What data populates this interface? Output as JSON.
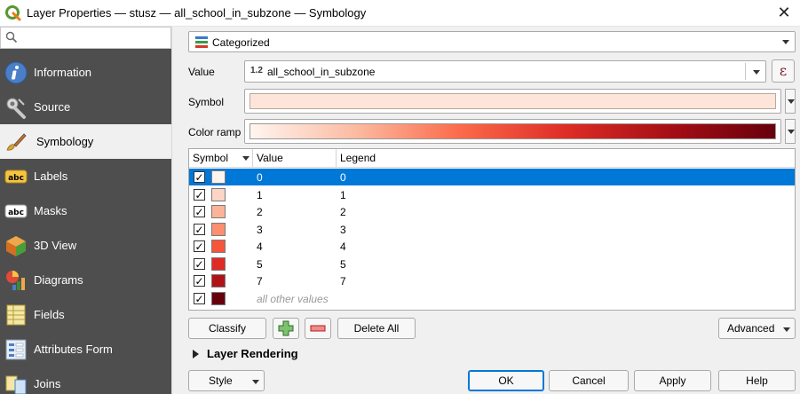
{
  "window": {
    "title": "Layer Properties — stusz — all_school_in_subzone — Symbology",
    "close_glyph": "✕"
  },
  "sidebar": {
    "search_placeholder": "",
    "items": [
      {
        "label": "Information",
        "icon": "information-icon"
      },
      {
        "label": "Source",
        "icon": "source-icon"
      },
      {
        "label": "Symbology",
        "icon": "symbology-icon",
        "active": true
      },
      {
        "label": "Labels",
        "icon": "labels-icon"
      },
      {
        "label": "Masks",
        "icon": "masks-icon"
      },
      {
        "label": "3D View",
        "icon": "3d-view-icon"
      },
      {
        "label": "Diagrams",
        "icon": "diagrams-icon"
      },
      {
        "label": "Fields",
        "icon": "fields-icon"
      },
      {
        "label": "Attributes Form",
        "icon": "attributes-form-icon"
      },
      {
        "label": "Joins",
        "icon": "joins-icon"
      }
    ]
  },
  "renderer": {
    "selected": "Categorized"
  },
  "value_row": {
    "label": "Value",
    "type_badge": "1.2",
    "field": "all_school_in_subzone",
    "expression_glyph": "ε"
  },
  "symbol_row": {
    "label": "Symbol",
    "color": "#fee5d9"
  },
  "color_ramp_row": {
    "label": "Color ramp",
    "colors": [
      "#fff5f0",
      "#fcbba1",
      "#fb6a4a",
      "#de2d26",
      "#a50f15",
      "#67000d"
    ]
  },
  "table": {
    "headers": {
      "symbol": "Symbol",
      "value": "Value",
      "legend": "Legend"
    },
    "rows": [
      {
        "checked": true,
        "color": "#fff5f0",
        "value": "0",
        "legend": "0",
        "selected": true
      },
      {
        "checked": true,
        "color": "#fdd5c4",
        "value": "1",
        "legend": "1"
      },
      {
        "checked": true,
        "color": "#fcb499",
        "value": "2",
        "legend": "2"
      },
      {
        "checked": true,
        "color": "#fc8f6f",
        "value": "3",
        "legend": "3"
      },
      {
        "checked": true,
        "color": "#f6553c",
        "value": "4",
        "legend": "4"
      },
      {
        "checked": true,
        "color": "#df2a26",
        "value": "5",
        "legend": "5"
      },
      {
        "checked": true,
        "color": "#b01217",
        "value": "7",
        "legend": "7"
      },
      {
        "checked": true,
        "color": "#67000d",
        "value": "all other values",
        "legend": "",
        "is_other": true
      }
    ],
    "check_glyph": "✓"
  },
  "actions": {
    "classify": "Classify",
    "delete_all": "Delete All",
    "advanced": "Advanced"
  },
  "layer_rendering": {
    "label": "Layer Rendering"
  },
  "footer": {
    "style": "Style",
    "ok": "OK",
    "cancel": "Cancel",
    "apply": "Apply",
    "help": "Help"
  },
  "colors": {
    "sidebar_bg": "#4e4e4e",
    "selection": "#0078d7",
    "expression": "#7b1e2c"
  }
}
